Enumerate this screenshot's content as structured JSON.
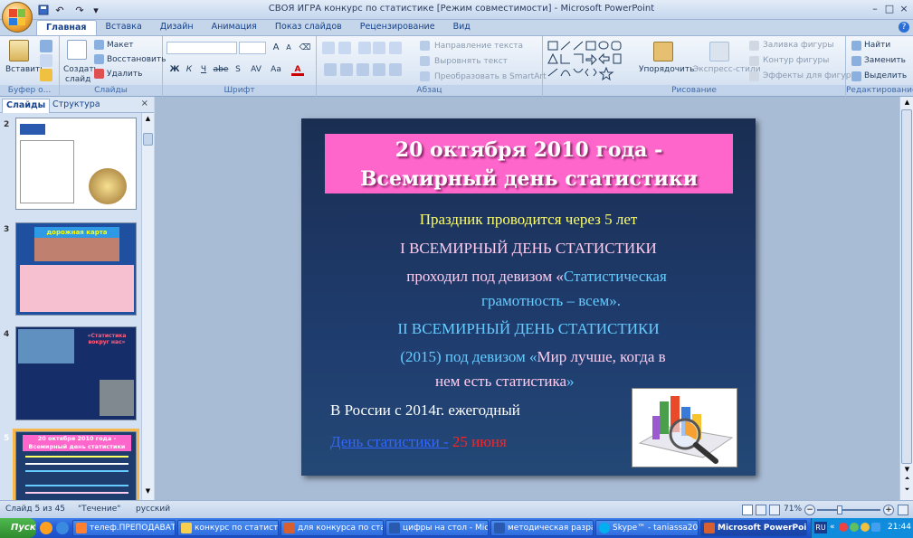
{
  "window": {
    "title": "СВОЯ ИГРА конкурс по статистике [Режим совместимости] - Microsoft PowerPoint",
    "controls": [
      "–",
      "□",
      "×"
    ]
  },
  "tabs": [
    "Главная",
    "Вставка",
    "Дизайн",
    "Анимация",
    "Показ слайдов",
    "Рецензирование",
    "Вид"
  ],
  "ribbon": {
    "clipboard": {
      "paste": "Вставить",
      "label": "Буфер о..."
    },
    "slides": {
      "create": "Создать",
      "create2": "слайд",
      "layout": "Макет",
      "reset": "Восстановить",
      "delete": "Удалить",
      "label": "Слайды"
    },
    "font": {
      "label": "Шрифт",
      "bold": "Ж",
      "italic": "К",
      "underline": "Ч",
      "strike": "abe",
      "shadow": "S",
      "spacing": "AV",
      "case": "Aa",
      "grow": "A",
      "shrink": "A"
    },
    "paragraph": {
      "direction": "Направление текста",
      "align": "Выровнять текст",
      "smartart": "Преобразовать в SmartArt",
      "label": "Абзац"
    },
    "drawing": {
      "arrange": "Упорядочить",
      "styles": "Экспресс-стили",
      "fill": "Заливка фигуры",
      "outline": "Контур фигуры",
      "effects": "Эффекты для фигур",
      "label": "Рисование"
    },
    "editing": {
      "find": "Найти",
      "replace": "Заменить",
      "select": "Выделить",
      "label": "Редактирование"
    }
  },
  "pane": {
    "tab_slides": "Слайды",
    "tab_outline": "Структура"
  },
  "thumbs": [
    {
      "num": "2",
      "title": ""
    },
    {
      "num": "3",
      "title": "дорожная карта"
    },
    {
      "num": "4",
      "title": "«Статистика вокруг нас»"
    },
    {
      "num": "5",
      "title": "20 октября 2010 года - Всемирный день статистики"
    }
  ],
  "slide": {
    "title_line1": "20 октября 2010 года -",
    "title_line2": "Всемирный день статистики",
    "line1": "Праздник   проводится   через 5 лет",
    "line2": "I  ВСЕМИРНЫЙ ДЕНЬ СТАТИСТИКИ",
    "line3a": "проходил под девизом «",
    "line3b": "Статистическая",
    "line4": "грамотность – всем».",
    "line5": "II ВСЕМИРНЫЙ ДЕНЬ СТАТИСТИКИ",
    "line6a": "(2015) под девизом «",
    "line6b": "Мир  лучше, когда  в",
    "line7a": "нем  есть   статистика",
    "line7b": "»",
    "line8": "В России  с 2014г. ежегодный",
    "line9a": "День  статистики  -",
    "line9b": " 25 июня"
  },
  "colors": {
    "title_bg": "#ff66cc",
    "yellow": "#ffff66",
    "cyan": "#66ccff",
    "pink": "#ffccee",
    "link": "#3366ff",
    "red": "#ff2222"
  },
  "status": {
    "slide": "Слайд 5 из 45",
    "theme": "\"Течение\"",
    "lang": "русский",
    "zoom": "71%"
  },
  "taskbar": {
    "start": "Пуск",
    "tasks": [
      "телеф.ПРЕПОДАВАТЕ...",
      "конкурс по статистик...",
      "для конкурса по стат...",
      "цифры на стол - Micro...",
      "методическая разраб...",
      "Skype™ - taniassa2008",
      "Microsoft PowerPoin..."
    ],
    "lang": "RU",
    "time": "21:44"
  }
}
